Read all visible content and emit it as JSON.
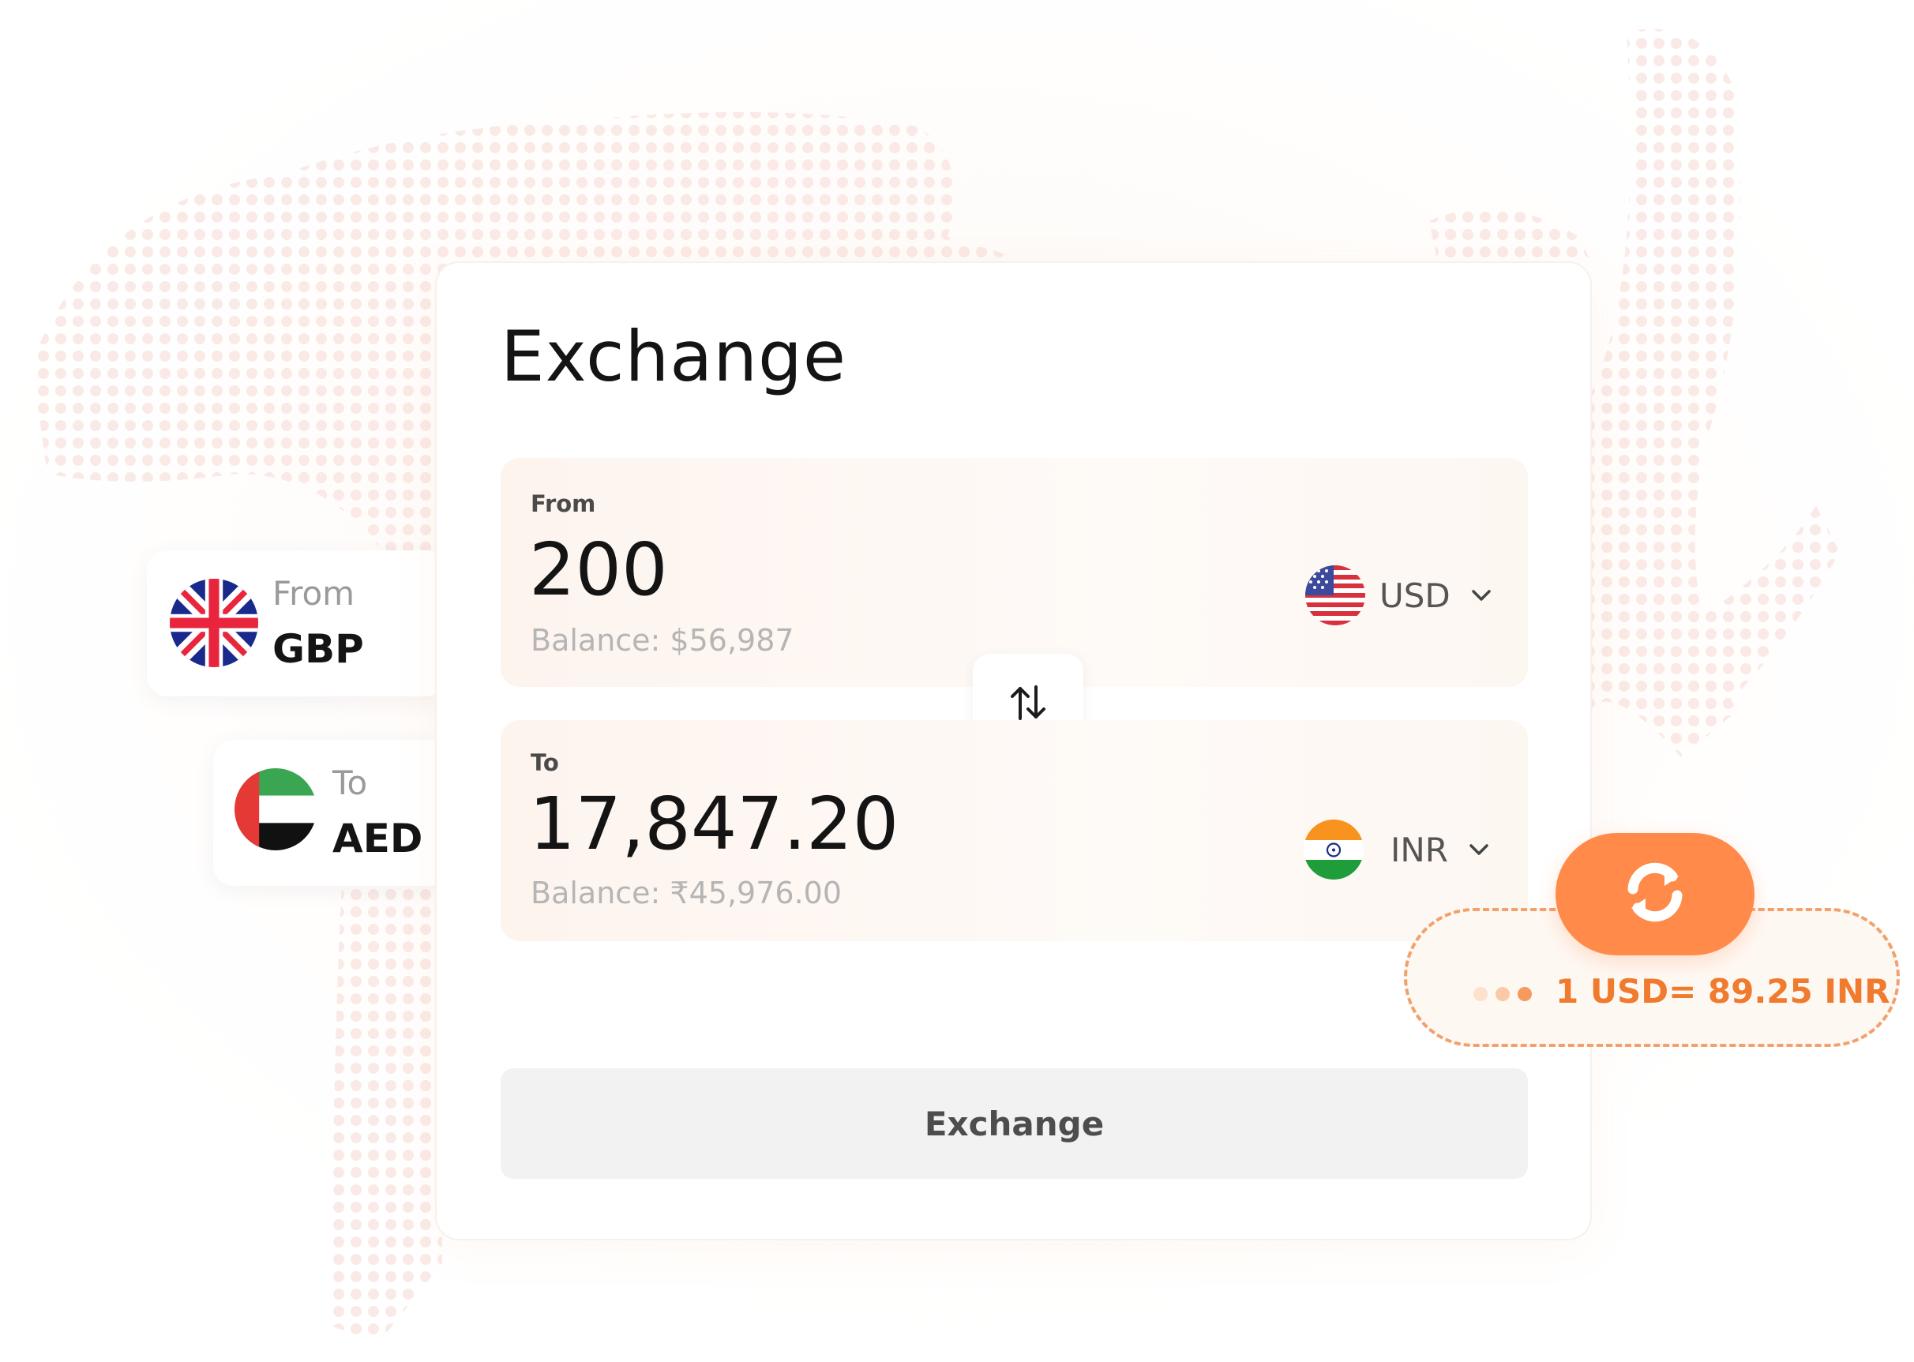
{
  "card": {
    "title": "Exchange"
  },
  "from_panel": {
    "label": "From",
    "amount": "200",
    "balance": "Balance: $56,987",
    "currency": "USD",
    "flag": "us-flag-icon"
  },
  "to_panel": {
    "label": "To",
    "amount": "17,847.20",
    "balance": "Balance: ₹45,976.00",
    "currency": "INR",
    "flag": "india-flag-icon"
  },
  "swap_icon": "swap-arrows-icon",
  "exchange_button": {
    "label": "Exchange"
  },
  "side_from": {
    "label": "From",
    "code": "GBP",
    "flag": "uk-flag-icon"
  },
  "side_to": {
    "label": "To",
    "code": "AED",
    "flag": "uae-flag-icon"
  },
  "rate": {
    "text": "1 USD= 89.25 INR",
    "icon": "refresh-icon"
  },
  "colors": {
    "accent": "#ff8a4a",
    "rate_text": "#f07a2e",
    "panel_bg": "#fdf4ee",
    "button_bg": "#f2f2f2",
    "title_text": "#141414",
    "muted_text": "#b5b5b5"
  }
}
